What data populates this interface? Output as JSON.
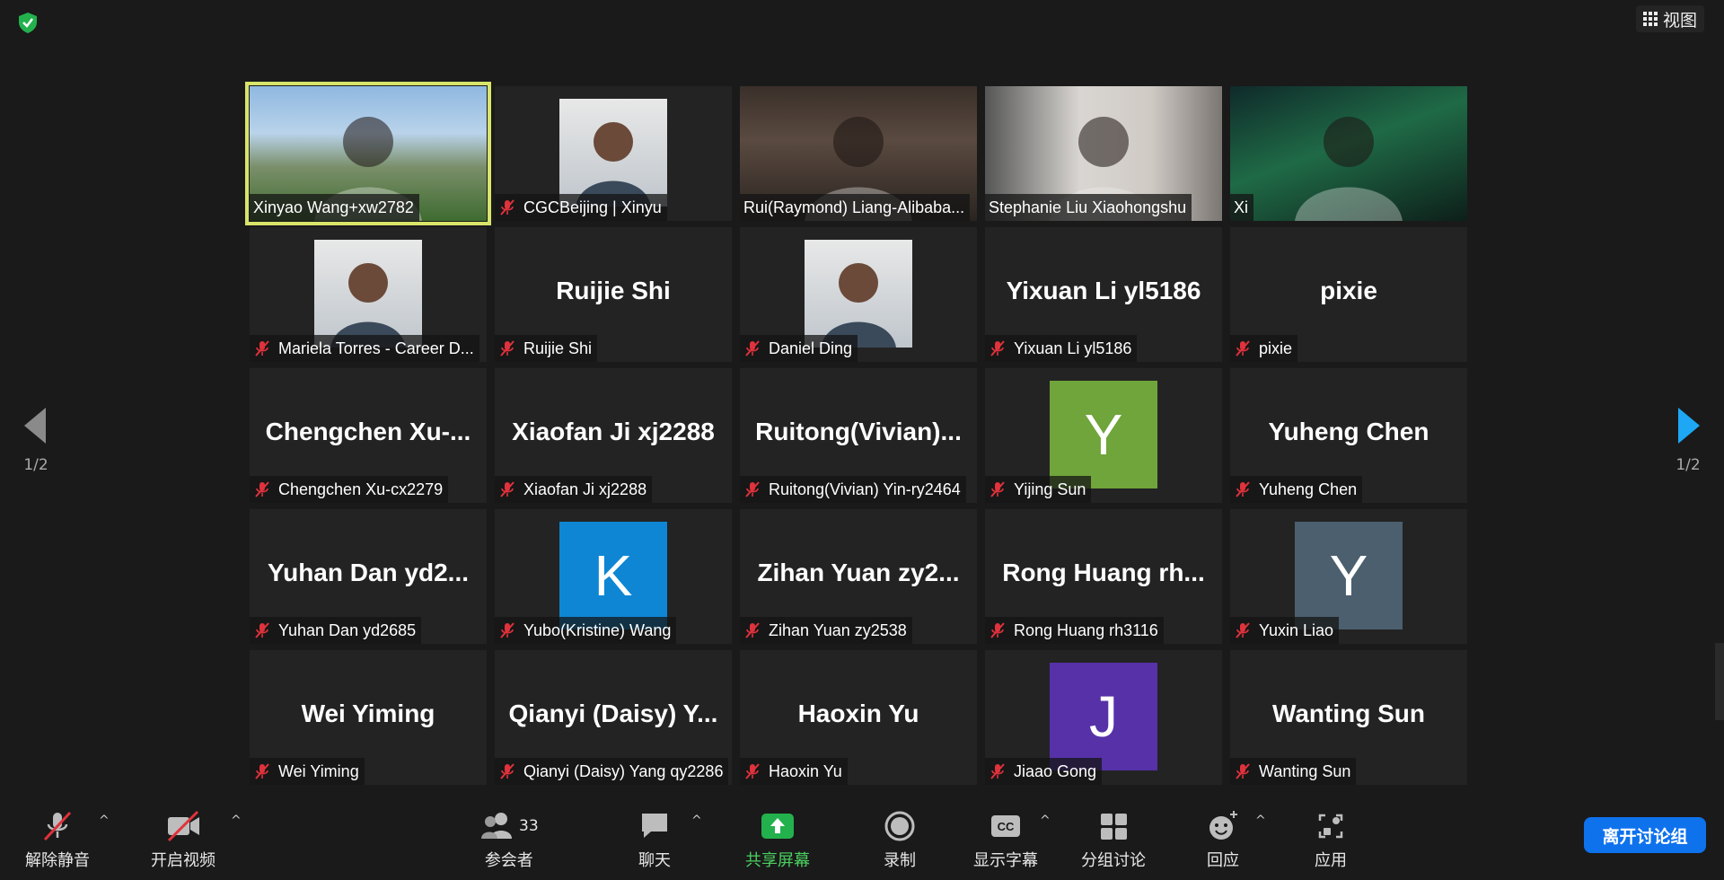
{
  "top": {
    "view_label": "视图"
  },
  "pager": {
    "left_page": "1/2",
    "right_page": "1/2"
  },
  "tiles": [
    {
      "name": "Xinyao Wang+xw2782",
      "type": "video",
      "muted": false,
      "active": true
    },
    {
      "name": "CGCBeijing | Xinyu",
      "type": "photo",
      "muted": true
    },
    {
      "name": "Rui(Raymond) Liang-Alibaba...",
      "type": "video",
      "muted": false
    },
    {
      "name": "Stephanie Liu Xiaohongshu",
      "type": "video",
      "muted": false
    },
    {
      "name": "Xi",
      "type": "video",
      "muted": false
    },
    {
      "name": "Mariela Torres - Career D...",
      "type": "photo",
      "muted": true
    },
    {
      "name": "Ruijie Shi",
      "type": "text",
      "display": "Ruijie Shi",
      "muted": true
    },
    {
      "name": "Daniel Ding",
      "type": "photo",
      "muted": true
    },
    {
      "name": "Yixuan Li yl5186",
      "type": "text",
      "display": "Yixuan Li yl5186",
      "muted": true
    },
    {
      "name": "pixie",
      "type": "text",
      "display": "pixie",
      "muted": true
    },
    {
      "name": "Chengchen Xu-cx2279",
      "type": "text",
      "display": "Chengchen  Xu-...",
      "muted": true
    },
    {
      "name": "Xiaofan Ji xj2288",
      "type": "text",
      "display": "Xiaofan Ji xj2288",
      "muted": true
    },
    {
      "name": "Ruitong(Vivian) Yin-ry2464",
      "type": "text",
      "display": "Ruitong(Vivian)...",
      "muted": true
    },
    {
      "name": "Yijing Sun",
      "type": "avatar",
      "letter": "Y",
      "color": "#6fa53a",
      "muted": true
    },
    {
      "name": "Yuheng Chen",
      "type": "text",
      "display": "Yuheng Chen",
      "muted": true
    },
    {
      "name": "Yuhan Dan yd2685",
      "type": "text",
      "display": "Yuhan  Dan  yd2...",
      "muted": true
    },
    {
      "name": "Yubo(Kristine) Wang",
      "type": "avatar",
      "letter": "K",
      "color": "#0e86d4",
      "muted": true
    },
    {
      "name": "Zihan Yuan zy2538",
      "type": "text",
      "display": "Zihan  Yuan  zy2...",
      "muted": true
    },
    {
      "name": "Rong Huang rh3116",
      "type": "text",
      "display": "Rong  Huang  rh...",
      "muted": true
    },
    {
      "name": "Yuxin Liao",
      "type": "avatar",
      "letter": "Y",
      "color": "#4b5f6e",
      "muted": true
    },
    {
      "name": "Wei Yiming",
      "type": "text",
      "display": "Wei Yiming",
      "muted": true
    },
    {
      "name": "Qianyi (Daisy) Yang qy2286",
      "type": "text",
      "display": "Qianyi  (Daisy)  Y...",
      "muted": true
    },
    {
      "name": "Haoxin Yu",
      "type": "text",
      "display": "Haoxin Yu",
      "muted": true
    },
    {
      "name": "Jiaao Gong",
      "type": "avatar",
      "letter": "J",
      "color": "#5631a8",
      "muted": true
    },
    {
      "name": "Wanting Sun",
      "type": "text",
      "display": "Wanting Sun",
      "muted": true
    }
  ],
  "toolbar": {
    "unmute": "解除静音",
    "start_video": "开启视频",
    "participants": "参会者",
    "participants_count": "33",
    "chat": "聊天",
    "share_screen": "共享屏幕",
    "record": "录制",
    "captions": "显示字幕",
    "breakout": "分组讨论",
    "reactions": "回应",
    "apps": "应用",
    "leave": "离开讨论组"
  },
  "colors": {
    "background": "#1a1a1a",
    "tile": "#232323",
    "active_border": "#d8e46a",
    "share_green": "#4bd060",
    "leave_blue": "#0e72ed",
    "mute_red": "#e0323c",
    "nav_arrow_blue": "#1ea7f5"
  }
}
